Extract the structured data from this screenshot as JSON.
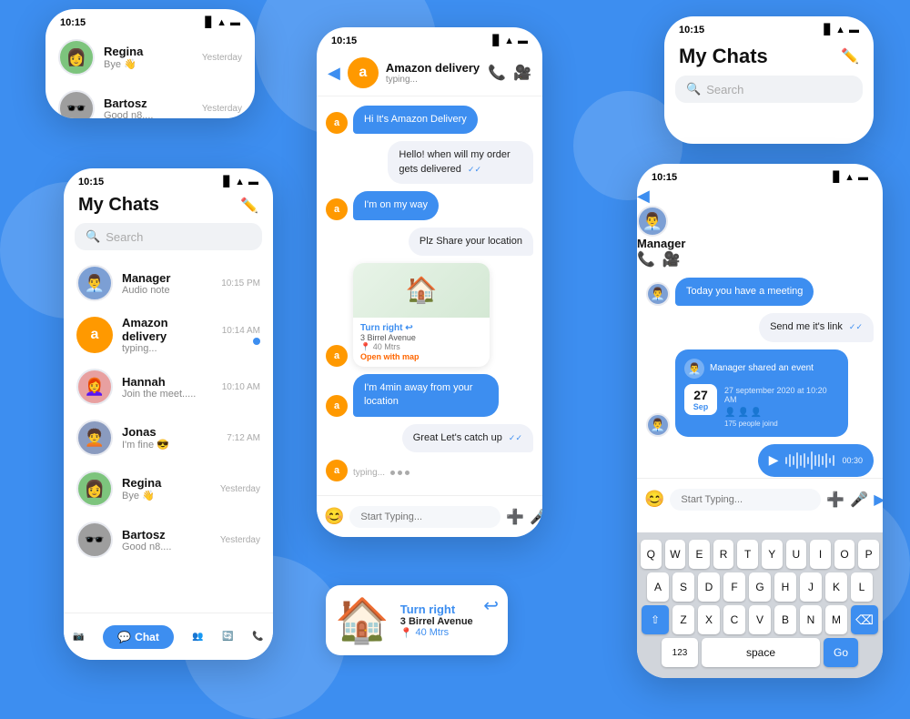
{
  "app": {
    "title": "My Chats",
    "status_time": "10:15",
    "search_placeholder": "Search"
  },
  "top_left_phone": {
    "contacts": [
      {
        "name": "Regina",
        "preview": "Bye 👋",
        "time": "Yesterday",
        "avatar": "👩"
      },
      {
        "name": "Bartosz",
        "preview": "Good n8....",
        "time": "Yesterday",
        "avatar": "🕶️"
      }
    ],
    "nav": {
      "camera": "📷",
      "chat": "Chat",
      "people": "👥",
      "refresh": "🔄",
      "phone": "📞"
    }
  },
  "left_phone": {
    "title": "My Chats",
    "contacts": [
      {
        "name": "Manager",
        "preview": "Audio note",
        "time": "10:15 PM",
        "avatar": "👨‍💼",
        "avatarBg": "#7c9fd4"
      },
      {
        "name": "Amazon delivery",
        "preview": "typing...",
        "time": "10:14 AM",
        "avatar": "a",
        "avatarBg": "#ff9900",
        "dot": true
      },
      {
        "name": "Hannah",
        "preview": "Join the meet.....",
        "time": "10:10 AM",
        "avatar": "👩‍🦰",
        "avatarBg": "#e8a0a0"
      },
      {
        "name": "Jonas",
        "preview": "I'm fine 😎",
        "time": "7:12 AM",
        "avatar": "🧑‍🦱",
        "avatarBg": "#8a9bbf"
      },
      {
        "name": "Regina",
        "preview": "Bye 👋",
        "time": "Yesterday",
        "avatar": "👩",
        "avatarBg": "#7dc47d"
      },
      {
        "name": "Bartosz",
        "preview": "Good n8....",
        "time": "Yesterday",
        "avatar": "🕶️",
        "avatarBg": "#9e9e9e"
      }
    ]
  },
  "mid_phone": {
    "contact_name": "Amazon delivery",
    "contact_status": "typing...",
    "messages": [
      {
        "type": "incoming",
        "text": "Hi It's Amazon Delivery"
      },
      {
        "type": "outgoing",
        "text": "Hello! when will my order gets delivered",
        "check": "✓✓"
      },
      {
        "type": "incoming",
        "text": "I'm on my way"
      },
      {
        "type": "outgoing",
        "text": "Plz Share your location"
      },
      {
        "type": "incoming",
        "map": true
      },
      {
        "type": "incoming",
        "text": "I'm 4min away from your location"
      },
      {
        "type": "outgoing",
        "text": "Great Let's catch up",
        "check": "✓✓"
      }
    ],
    "map": {
      "direction": "Turn right",
      "street": "3 Birrel Avenue",
      "distance": "40 Mtrs",
      "link": "Open with map"
    },
    "typing_text": "typing...",
    "input_placeholder": "Start Typing..."
  },
  "right_top_phone": {
    "title": "My Chats",
    "search_placeholder": "Search"
  },
  "right_chat_phone": {
    "contact_name": "Manager",
    "messages": [
      {
        "type": "incoming",
        "text": "Today you have a meeting"
      },
      {
        "type": "outgoing",
        "text": "Send me it's link",
        "check": "✓✓"
      },
      {
        "type": "event",
        "sender": "Manager",
        "action": "shared an event",
        "date_num": "27",
        "date_mon": "Sep",
        "date_full": "27 september 2020 at 10:20 AM",
        "people": "175 people joind"
      },
      {
        "type": "audio",
        "duration": "00:30"
      }
    ],
    "input_placeholder": "Start Typing...",
    "keyboard": {
      "rows": [
        [
          "Q",
          "W",
          "E",
          "R",
          "T",
          "Y",
          "U",
          "I",
          "O",
          "P"
        ],
        [
          "A",
          "S",
          "D",
          "F",
          "G",
          "H",
          "J",
          "K",
          "L"
        ],
        [
          "⇧",
          "Z",
          "X",
          "C",
          "V",
          "B",
          "N",
          "M",
          "⌫"
        ],
        [
          "123",
          "space",
          "Go"
        ]
      ]
    }
  },
  "map_bottom": {
    "direction": "Turn right",
    "street": "3 Birrel Avenue",
    "distance": "40 Mtrs"
  }
}
